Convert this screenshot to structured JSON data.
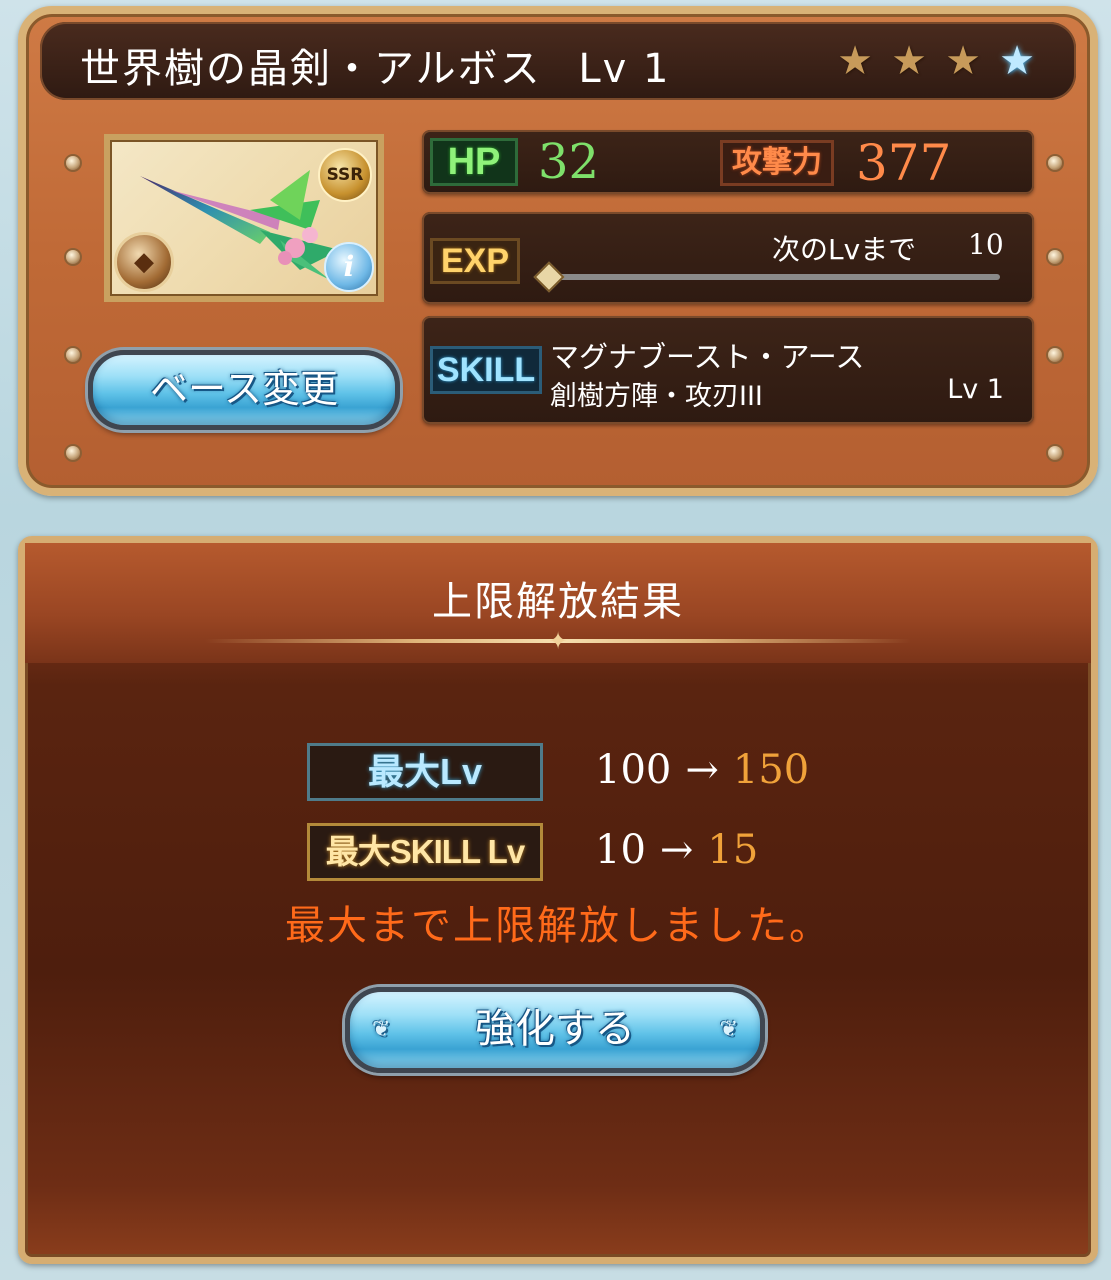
{
  "weapon": {
    "title": "世界樹の晶剣・アルボス",
    "level_label": "Lv 1",
    "rarity": "SSR",
    "stars": [
      {
        "icon": "star-icon",
        "state": "filled-bronze"
      },
      {
        "icon": "star-icon",
        "state": "filled-bronze"
      },
      {
        "icon": "star-icon",
        "state": "filled-bronze"
      },
      {
        "icon": "star-icon",
        "state": "filled-blue"
      }
    ],
    "element_icon": "earth-element-icon",
    "info_icon": "info-icon"
  },
  "stats": {
    "hp_label": "HP",
    "hp_value": "32",
    "atk_label": "攻撃力",
    "atk_value": "377",
    "exp_label": "EXP",
    "next_lv_label": "次のLvまで",
    "next_lv_value": "10",
    "exp_progress": 0.0
  },
  "skill": {
    "label": "SKILL",
    "name": "マグナブースト・アース",
    "sub_name": "創樹方陣・攻刃III",
    "level": "Lv 1"
  },
  "buttons": {
    "base_change": "ベース変更",
    "enhance": "強化する"
  },
  "result": {
    "title": "上限解放結果",
    "max_lv_label": "最大Lv",
    "max_lv_from": "100",
    "max_lv_to": "150",
    "max_skill_label": "最大SKILL Lv",
    "max_skill_from": "10",
    "max_skill_to": "15",
    "arrow": "→",
    "notice": "最大まで上限解放しました。"
  },
  "colors": {
    "panel_orange": "#c06a37",
    "hp_green": "#7ee06a",
    "atk_orange": "#ff8a4a",
    "result_gold": "#f0a23a",
    "notice_orange": "#ff6a1a",
    "button_blue": "#5fc2e8"
  }
}
